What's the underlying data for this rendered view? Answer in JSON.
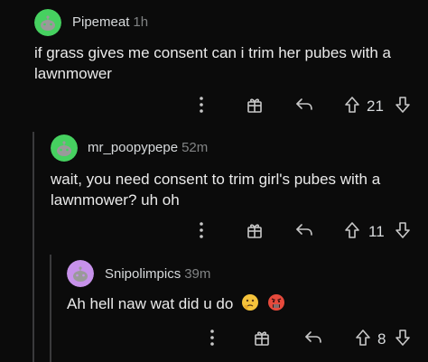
{
  "comments": [
    {
      "username": "Pipemeat",
      "time": "1h",
      "text": "if grass gives me consent can i trim her pubes with a lawnmower",
      "votes": "21",
      "avatar_color": "#46d160"
    },
    {
      "username": "mr_poopypepe",
      "time": "52m",
      "text": "wait, you need consent to trim girl's pubes with a lawnmower? uh oh",
      "votes": "11",
      "avatar_color": "#46d160"
    },
    {
      "username": "Snipolimpics",
      "time": "39m",
      "text": "Ah hell naw wat did u do",
      "votes": "8",
      "avatar_color": "#c792ea"
    }
  ],
  "icons": {
    "more": "more-options-icon",
    "award": "award-icon",
    "reply": "reply-icon",
    "upvote": "upvote-icon",
    "downvote": "downvote-icon",
    "emoji1": "thinking-face-emoji",
    "emoji2": "angry-face-emoji"
  },
  "colors": {
    "background": "#0b0b0b",
    "thread_line": "#3a3a3c",
    "text": "#eaeaea",
    "muted": "#818384"
  }
}
